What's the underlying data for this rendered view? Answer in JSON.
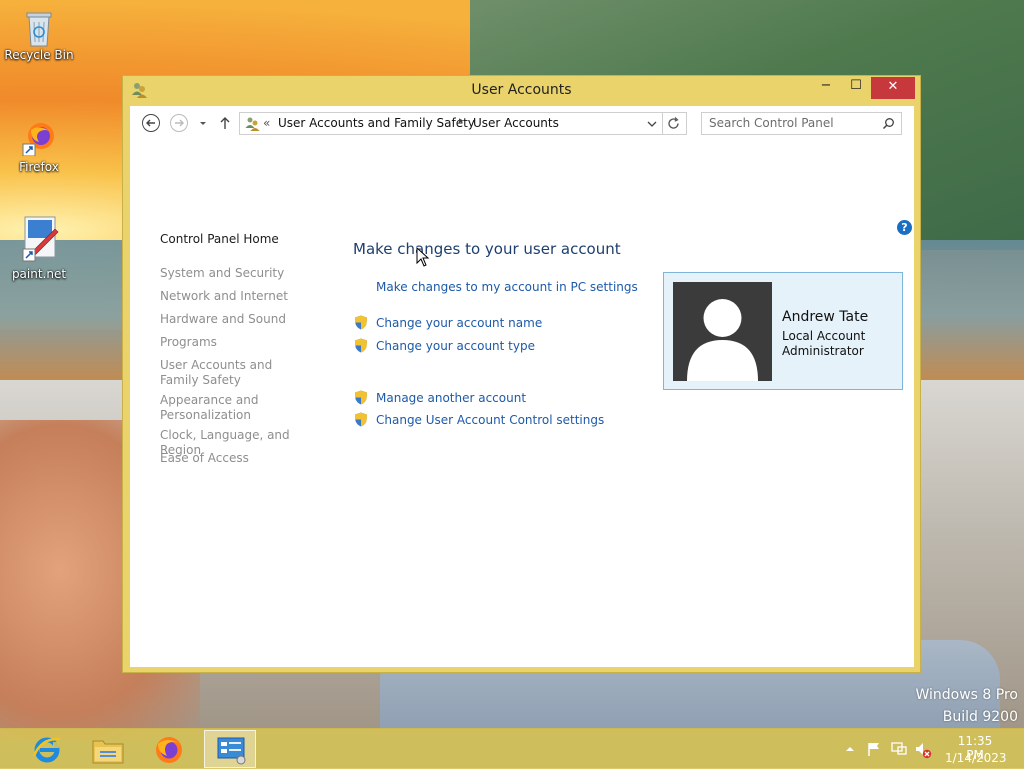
{
  "desktop": {
    "icons": [
      {
        "label": "Recycle Bin",
        "icon": "recycle-bin-icon"
      },
      {
        "label": "Firefox",
        "icon": "firefox-icon"
      },
      {
        "label": "paint.net",
        "icon": "paint-net-icon"
      }
    ],
    "watermark": {
      "line1": "Windows 8 Pro",
      "line2": "Build 9200"
    }
  },
  "window": {
    "title": "User Accounts",
    "icon": "user-accounts-icon",
    "controls": {
      "minimize": "−",
      "maximize": "☐",
      "close": "✕"
    },
    "address": {
      "prefix": "«",
      "crumbs": [
        "User Accounts and Family Safety",
        "User Accounts"
      ],
      "separator": "▸"
    },
    "search": {
      "placeholder": "Search Control Panel"
    },
    "help": "?",
    "left_nav": {
      "home": "Control Panel Home",
      "items": [
        "System and Security",
        "Network and Internet",
        "Hardware and Sound",
        "Programs",
        "User Accounts and Family Safety",
        "Appearance and Personalization",
        "Clock, Language, and Region",
        "Ease of Access"
      ]
    },
    "main": {
      "heading": "Make changes to your user account",
      "pc_settings_link": "Make changes to my account in PC settings",
      "links": [
        "Change your account name",
        "Change your account type",
        "Manage another account",
        "Change User Account Control settings"
      ]
    },
    "account": {
      "name": "Andrew Tate",
      "type": "Local Account",
      "role": "Administrator"
    }
  },
  "taskbar": {
    "apps": [
      "internet-explorer-icon",
      "file-explorer-icon",
      "firefox-icon",
      "control-panel-icon"
    ],
    "active_app": "control-panel-icon",
    "clock": {
      "time": "11:35 PM",
      "date": "1/14/2023"
    }
  }
}
